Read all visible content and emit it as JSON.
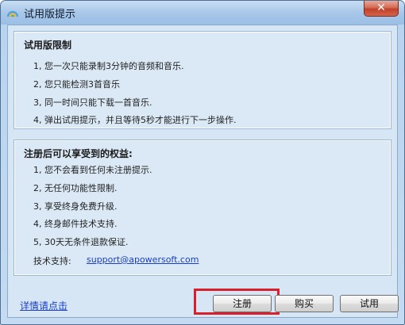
{
  "window": {
    "title": "试用版提示",
    "close_symbol": "✕",
    "icon": "rainbow-logo-icon"
  },
  "trial_limits": {
    "heading": "试用版限制",
    "items": [
      "1, 您一次只能录制3分钟的音频和音乐.",
      "2, 您只能检测3首音乐",
      "3, 同一时间只能下载一首音乐.",
      "4, 弹出试用提示，并且等待5秒才能进行下一步操作."
    ]
  },
  "benefits": {
    "heading": "注册后可以享受到的权益:",
    "items": [
      "1, 您不会看到任何未注册提示.",
      "2, 无任何功能性限制.",
      "3, 享受终身免费升级.",
      "4, 终身邮件技术支持.",
      "5, 30天无条件退款保证."
    ],
    "support_label": "技术支持:",
    "support_email": "support@apowersoft.com"
  },
  "footer": {
    "details_link": "详情请点击",
    "register_label": "注册",
    "buy_label": "购买",
    "trial_label": "试用"
  },
  "colors": {
    "highlight": "#d8202c",
    "link": "#1a3fc4"
  }
}
